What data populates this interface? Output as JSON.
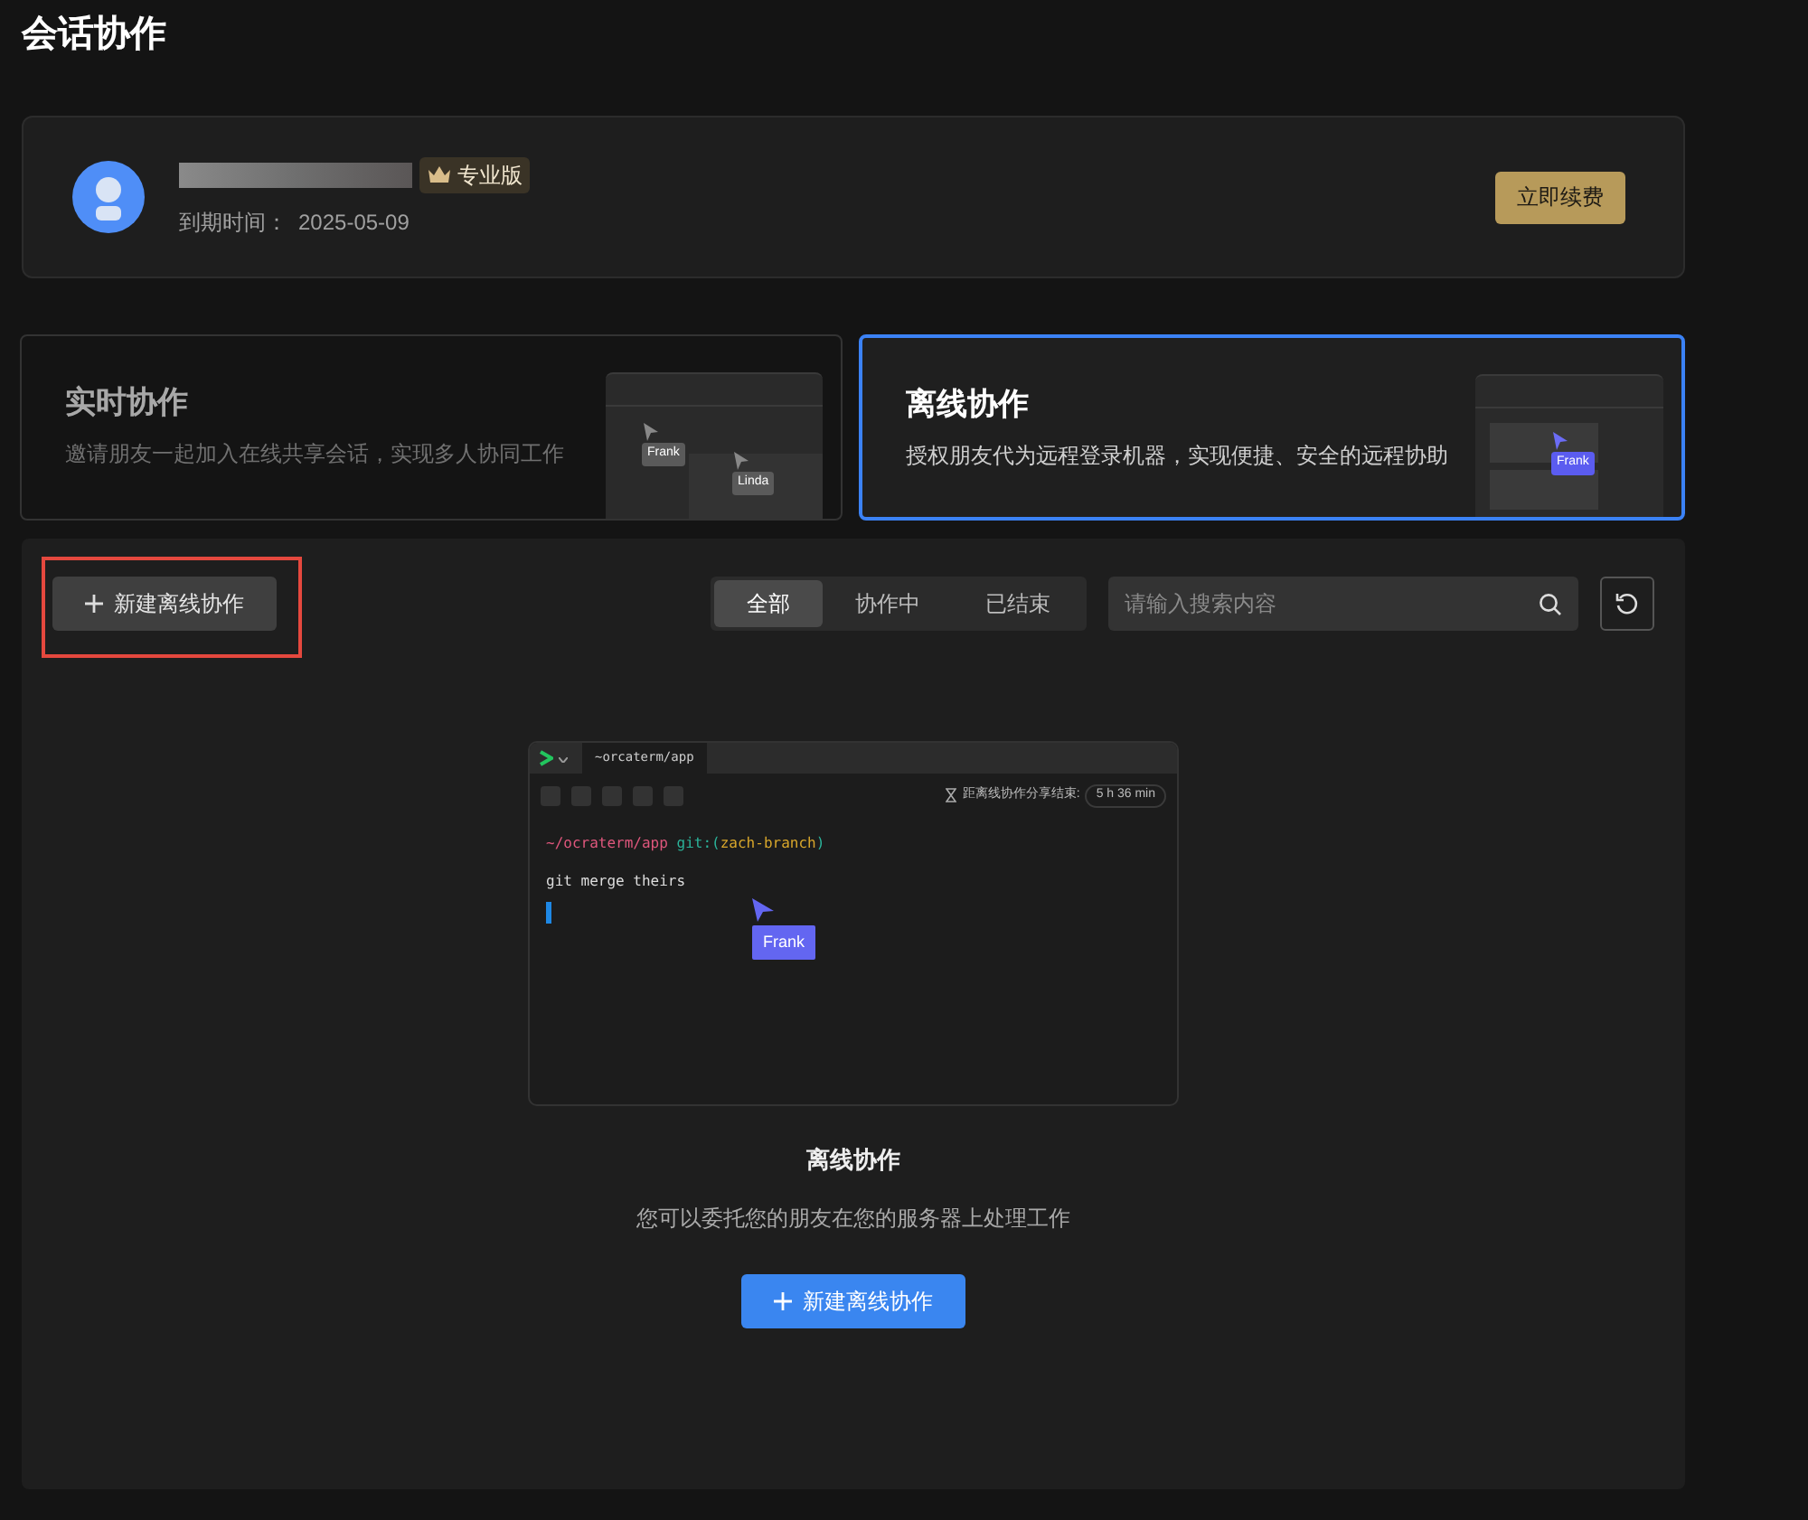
{
  "page_title": "会话协作",
  "account": {
    "plan_badge": "专业版",
    "expiry_label": "到期时间：",
    "expiry_date": "2025-05-09",
    "renew_button": "立即续费"
  },
  "modes": [
    {
      "title": "实时协作",
      "description": "邀请朋友一起加入在线共享会话，实现多人协同工作",
      "selected": false,
      "kind": "realtime",
      "cursor_labels": [
        "Frank",
        "Linda"
      ]
    },
    {
      "title": "离线协作",
      "description": "授权朋友代为远程登录机器，实现便捷、安全的远程协助",
      "selected": true,
      "kind": "offline",
      "cursor_labels": [
        "Frank"
      ]
    }
  ],
  "toolbar": {
    "new_button": "新建离线协作",
    "highlighted": true,
    "filters": [
      {
        "label": "全部",
        "selected": true
      },
      {
        "label": "协作中",
        "selected": false
      },
      {
        "label": "已结束",
        "selected": false
      }
    ],
    "search": {
      "placeholder": "请输入搜索内容"
    }
  },
  "empty_state": {
    "preview": {
      "tab": "~orcaterm/app",
      "countdown_label": "距离线协作分享结束:",
      "countdown_value": "5 h 36 min",
      "prompt_path": "~/ocraterm/app",
      "prompt_git": "git:(",
      "prompt_branch": "zach-branch",
      "prompt_close": ")",
      "command": "git merge theirs",
      "cursor_label": "Frank"
    },
    "title": "离线协作",
    "description": "您可以委托您的朋友在您的服务器上处理工作",
    "button": "新建离线协作"
  }
}
